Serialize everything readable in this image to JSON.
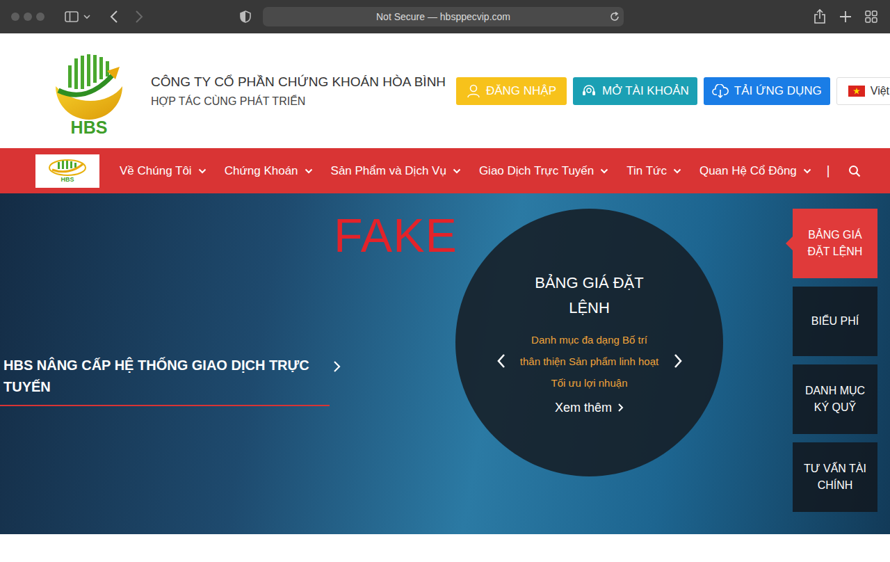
{
  "browser": {
    "address": "Not Secure — hbsppecvip.com"
  },
  "header": {
    "logo_text": "HBS",
    "company": "CÔNG TY CỔ PHẦN CHỨNG KHOÁN HÒA BÌNH",
    "slogan": "HỢP TÁC CÙNG PHÁT TRIỂN",
    "buttons": [
      {
        "label": "ĐĂNG NHẬP",
        "kind": "login",
        "color": "#f7c21b"
      },
      {
        "label": "MỞ TÀI KHOẢN",
        "kind": "register",
        "color": "#1ba0b4"
      },
      {
        "label": "TẢI ỨNG DỤNG",
        "kind": "download",
        "color": "#1a7de6"
      }
    ],
    "language": "Việt"
  },
  "nav": {
    "logo_text": "HBS",
    "items": [
      "Về Chúng Tôi",
      "Chứng Khoán",
      "Sản Phẩm và Dịch Vụ",
      "Giao Dịch Trực Tuyến",
      "Tin Tức",
      "Quan Hệ Cổ Đông"
    ],
    "separator": "|"
  },
  "hero": {
    "headline": "HBS NÂNG CẤP HỆ THỐNG GIAO DỊCH TRỰC TUYẾN",
    "watermark": "FAKE",
    "slide": {
      "title": "BẢNG GIÁ ĐẶT LỆNH",
      "description": "Danh mục đa dạng Bố trí thân thiện Sản phẩm linh hoạt Tối ưu lợi nhuận",
      "link": "Xem thêm"
    },
    "side_tabs": [
      {
        "label": "BẢNG GIÁ ĐẶT LỆNH",
        "selected": true
      },
      {
        "label": "BIỂU PHÍ",
        "selected": false
      },
      {
        "label": "DANH MỤC KÝ QUỸ",
        "selected": false
      },
      {
        "label": "TƯ VẤN TÀI CHÍNH",
        "selected": false
      }
    ]
  }
}
